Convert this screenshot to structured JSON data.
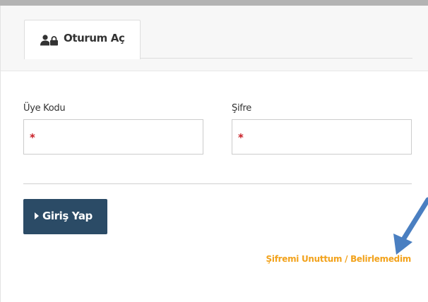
{
  "tab": {
    "label": "Oturum Aç",
    "icon": "user-lock-icon"
  },
  "form": {
    "member_code": {
      "label": "Üye Kodu",
      "value": "",
      "required_marker": "*"
    },
    "password": {
      "label": "Şifre",
      "value": "",
      "required_marker": "*"
    }
  },
  "actions": {
    "login_label": "Giriş Yap",
    "forgot_label": "Şifremi Unuttum / Belirlemedim"
  },
  "colors": {
    "button_bg": "#2b4b66",
    "link": "#f2a21b",
    "required": "#c81d25",
    "annotation_arrow": "#4a7fc1"
  }
}
